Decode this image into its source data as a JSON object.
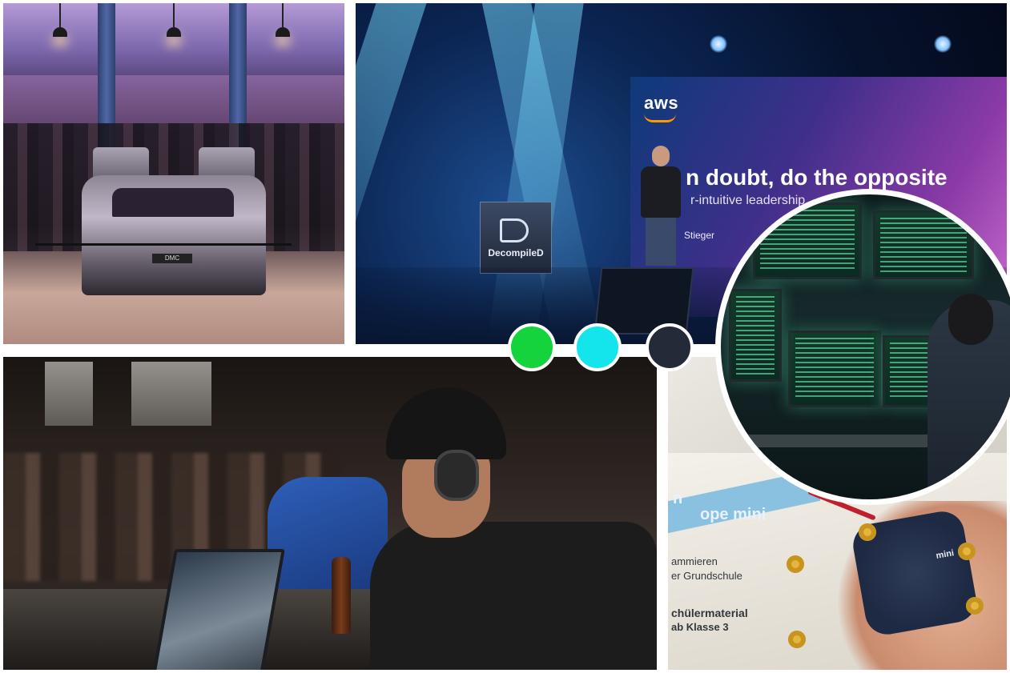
{
  "collage": {
    "stage": {
      "aws_logo": "aws",
      "slide_title": "n doubt, do the opposite",
      "slide_subtitle": "r-intuitive leadership",
      "slide_name": "Stieger",
      "podium_brand": "DecompileD"
    },
    "car": {
      "plate": "DMC"
    },
    "calliope": {
      "brand_line1": "n",
      "brand_line2": "ope mini",
      "text1": "ammieren",
      "text2": "er Grundschule",
      "text3": "chülermaterial",
      "text4": "ab Klasse 3",
      "board_label": "mini"
    },
    "dots": [
      {
        "name": "green-dot",
        "color": "#15d33c"
      },
      {
        "name": "cyan-dot",
        "color": "#14e4ec"
      },
      {
        "name": "navy-dot",
        "color": "#242a38"
      }
    ]
  }
}
